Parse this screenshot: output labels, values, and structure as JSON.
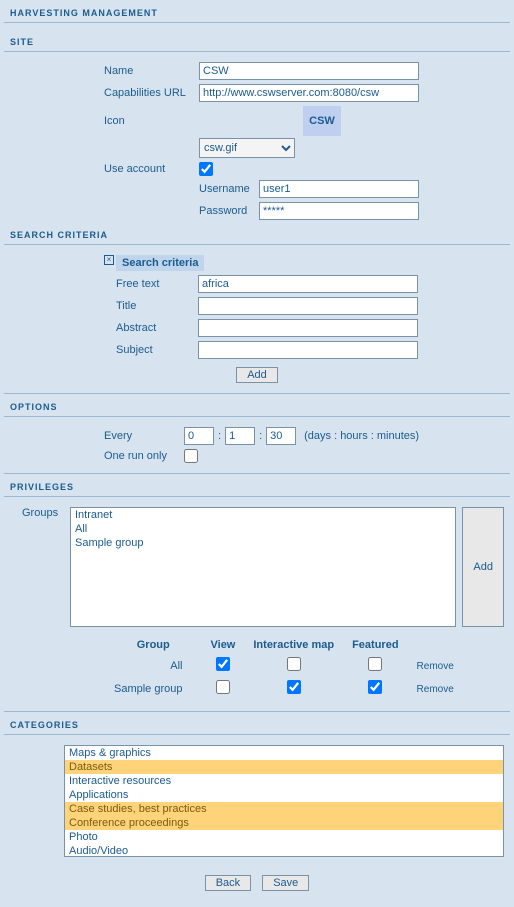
{
  "title": "HARVESTING MANAGEMENT",
  "site": {
    "header": "SITE",
    "name_label": "Name",
    "name": "CSW",
    "caps_label": "Capabilities URL",
    "caps": "http://www.cswserver.com:8080/csw",
    "icon_label": "Icon",
    "icon_select": "csw.gif",
    "icon_text": "CSW",
    "use_account_label": "Use account",
    "use_account": true,
    "username_label": "Username",
    "username": "user1",
    "password_label": "Password",
    "password": "*****"
  },
  "search": {
    "header": "SEARCH CRITERIA",
    "box_title": "Search criteria",
    "freetext_label": "Free text",
    "freetext": "africa",
    "title_label": "Title",
    "title": "",
    "abstract_label": "Abstract",
    "abstract": "",
    "subject_label": "Subject",
    "subject": "",
    "add": "Add"
  },
  "options": {
    "header": "OPTIONS",
    "every_label": "Every",
    "days": "0",
    "hours": "1",
    "minutes": "30",
    "hint": "(days : hours : minutes)",
    "one_run_label": "One run only",
    "one_run": false
  },
  "privileges": {
    "header": "PRIVILEGES",
    "groups_label": "Groups",
    "groups": [
      "Intranet",
      "All",
      "Sample group"
    ],
    "add": "Add",
    "table": {
      "headers": {
        "group": "Group",
        "view": "View",
        "imap": "Interactive map",
        "featured": "Featured"
      },
      "rows": [
        {
          "name": "All",
          "view": true,
          "imap": false,
          "featured": false
        },
        {
          "name": "Sample group",
          "view": false,
          "imap": true,
          "featured": true
        }
      ],
      "remove": "Remove"
    }
  },
  "categories": {
    "header": "CATEGORIES",
    "items": [
      {
        "label": "Maps & graphics",
        "sel": false
      },
      {
        "label": "Datasets",
        "sel": true
      },
      {
        "label": "Interactive resources",
        "sel": false
      },
      {
        "label": "Applications",
        "sel": false
      },
      {
        "label": "Case studies, best practices",
        "sel": true
      },
      {
        "label": "Conference proceedings",
        "sel": true
      },
      {
        "label": "Photo",
        "sel": false
      },
      {
        "label": "Audio/Video",
        "sel": false
      }
    ]
  },
  "footer": {
    "back": "Back",
    "save": "Save"
  }
}
